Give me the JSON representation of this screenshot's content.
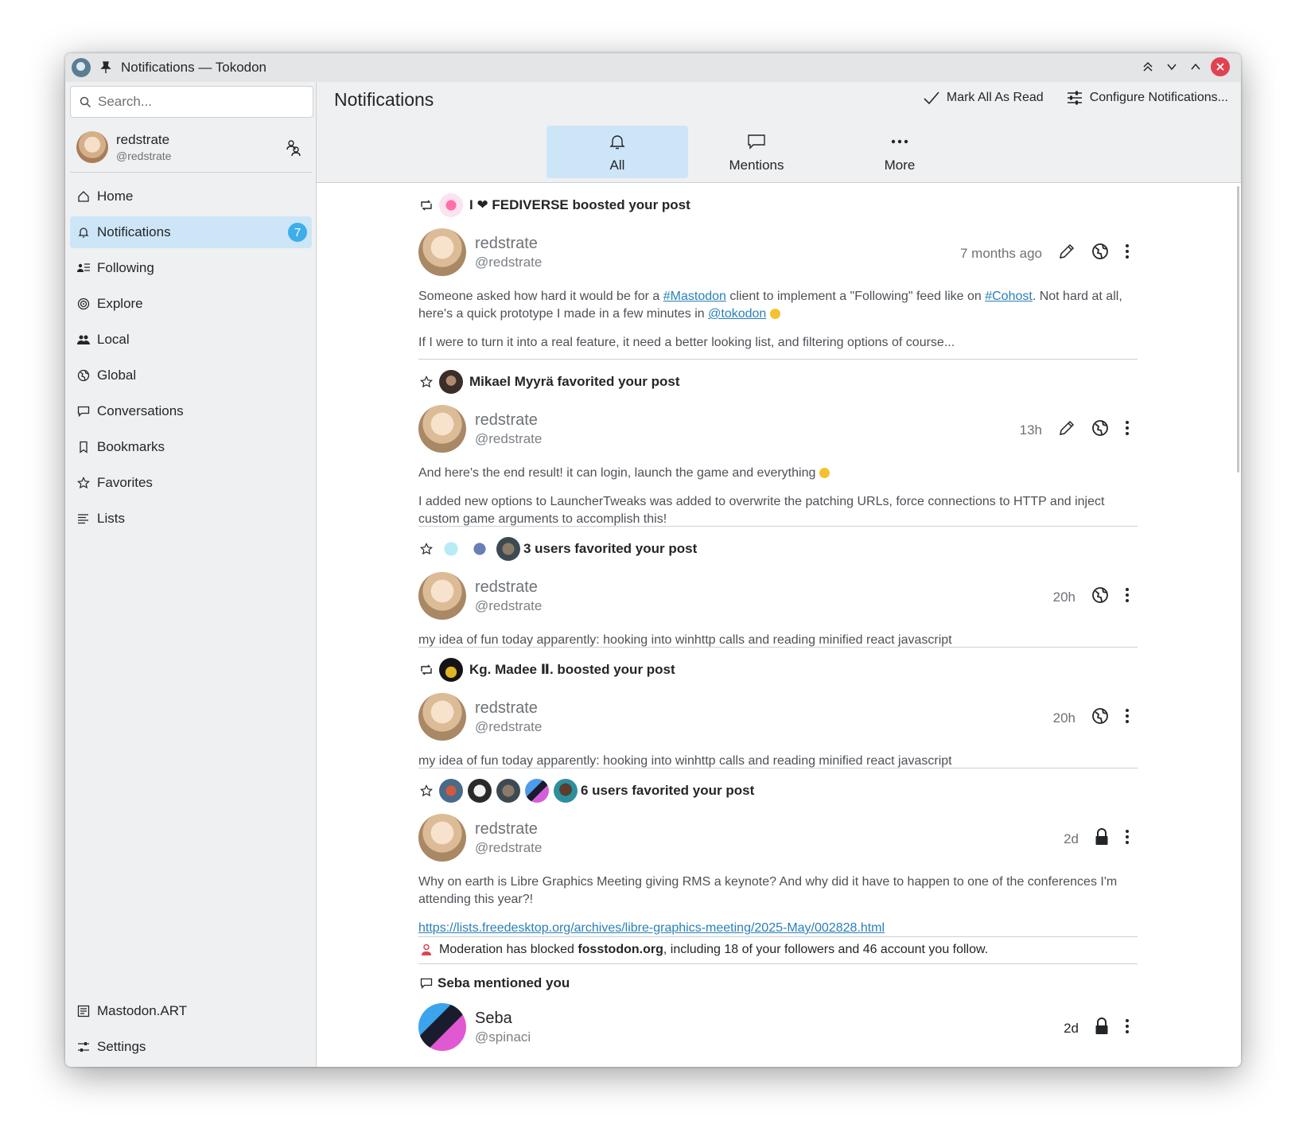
{
  "window": {
    "title": "Notifications — Tokodon"
  },
  "search": {
    "placeholder": "Search..."
  },
  "account": {
    "name": "redstrate",
    "handle": "@redstrate"
  },
  "nav": {
    "items": [
      {
        "label": "Home",
        "icon": "home-icon"
      },
      {
        "label": "Notifications",
        "icon": "bell-icon",
        "badge": "7",
        "active": true
      },
      {
        "label": "Following",
        "icon": "following-icon"
      },
      {
        "label": "Explore",
        "icon": "explore-icon"
      },
      {
        "label": "Local",
        "icon": "users-icon"
      },
      {
        "label": "Global",
        "icon": "globe-icon"
      },
      {
        "label": "Conversations",
        "icon": "chat-icon"
      },
      {
        "label": "Bookmarks",
        "icon": "bookmark-icon"
      },
      {
        "label": "Favorites",
        "icon": "star-icon"
      },
      {
        "label": "Lists",
        "icon": "list-icon"
      }
    ],
    "bottom": [
      {
        "label": "Mastodon.ART",
        "icon": "server-icon"
      },
      {
        "label": "Settings",
        "icon": "settings-icon"
      }
    ]
  },
  "header": {
    "title": "Notifications",
    "mark_read": "Mark All As Read",
    "configure": "Configure Notifications..."
  },
  "tabs": [
    {
      "label": "All",
      "active": true
    },
    {
      "label": "Mentions"
    },
    {
      "label": "More"
    }
  ],
  "notifications": [
    {
      "kind": "boost",
      "actor": "I ❤ FEDIVERSE",
      "action": "boosted your post",
      "author": "redstrate",
      "handle": "@redstrate",
      "time": "7 months ago",
      "body": [
        [
          "Someone asked how hard it would be for a ",
          "#Mastodon",
          " client to implement a \"Following\" feed like on ",
          "#Cohost",
          ". Not hard at all, here's a quick prototype I made in a few minutes in ",
          "@tokodon"
        ],
        "If I were to turn it into a real feature, it need a better looking list, and filtering options of course..."
      ]
    },
    {
      "kind": "favorite",
      "text": "Mikael Myyrä favorited your post",
      "author": "redstrate",
      "handle": "@redstrate",
      "time": "13h",
      "body": [
        "And here's the end result! it can login, launch the game and everything",
        "I added new options to LauncherTweaks was added to overwrite the patching URLs, force connections to HTTP and inject custom game arguments to accomplish this!"
      ]
    },
    {
      "kind": "favorite",
      "text": "3 users favorited your post",
      "author": "redstrate",
      "handle": "@redstrate",
      "time": "20h",
      "body": [
        "my idea of fun today apparently: hooking into winhttp calls and reading minified react javascript"
      ]
    },
    {
      "kind": "boost",
      "text": "Kg. Madee Ⅱ. boosted your post",
      "author": "redstrate",
      "handle": "@redstrate",
      "time": "20h",
      "body": [
        "my idea of fun today apparently: hooking into winhttp calls and reading minified react javascript"
      ]
    },
    {
      "kind": "favorite",
      "text": "6 users favorited your post",
      "author": "redstrate",
      "handle": "@redstrate",
      "time": "2d",
      "body": [
        "Why on earth is Libre Graphics Meeting giving RMS a keynote? And why did it have to happen to one of the conferences I'm attending this year?!",
        "https://lists.freedesktop.org/archives/libre-graphics-meeting/2025-May/002828.html"
      ]
    },
    {
      "kind": "moderation",
      "parts": [
        "Moderation has blocked ",
        "fosstodon.org",
        ", including 18 of your followers and 46 account you follow."
      ]
    },
    {
      "kind": "mention",
      "text": "Seba mentioned you",
      "author": "Seba",
      "handle": "@spinaci",
      "time": "2d"
    }
  ],
  "colors": {
    "accent": "#3daee9",
    "selection": "#cde6f7",
    "link": "#2980b9",
    "close": "#e0424f"
  }
}
